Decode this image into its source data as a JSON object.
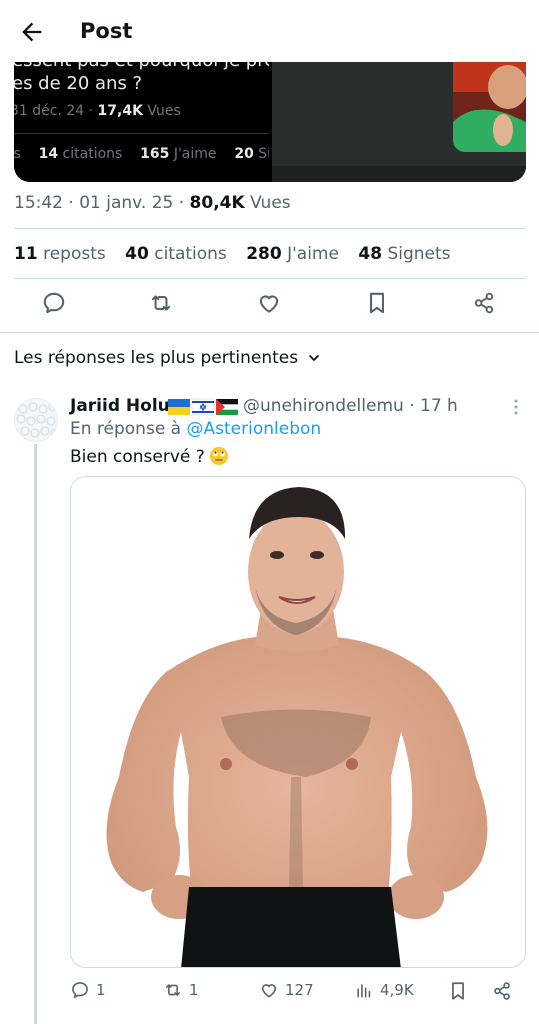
{
  "header": {
    "title": "Post",
    "back_icon": "arrow-left-icon"
  },
  "quoted_card": {
    "cut_line": "essent pas et pourquoi je préfè",
    "text_line": "es de 20 ans ?",
    "date": "31 déc. 24 · ",
    "views_value": "17,4K",
    "views_label": " Vues",
    "stats": [
      {
        "value": "",
        "label": "ts"
      },
      {
        "value": "14",
        "label": "citations"
      },
      {
        "value": "165",
        "label": "J'aime"
      },
      {
        "value": "20",
        "label": "Signets"
      }
    ]
  },
  "post": {
    "time": "15:42 · 01 janv. 25 · ",
    "views_value": "80,4K",
    "views_label": " Vues",
    "reposts_count": "11",
    "reposts_label": "reposts",
    "quotes_count": "40",
    "quotes_label": "citations",
    "likes_count": "280",
    "likes_label": "J'aime",
    "bookmarks_count": "48",
    "bookmarks_label": "Signets"
  },
  "actions": [
    "reply-icon",
    "repost-icon",
    "like-icon",
    "bookmark-icon",
    "share-icon"
  ],
  "replies_sort": {
    "label": "Les réponses les plus pertinentes"
  },
  "reply": {
    "name": "Jariid Holu",
    "handle": "@unehirondellemu · 17 h",
    "reply_prefix": "En réponse à ",
    "reply_mention": "@Asterionlebon",
    "text": "Bien conservé ?",
    "emoji": "rolling-eyes-emoji",
    "counts": {
      "replies": "1",
      "reposts": "1",
      "likes": "127",
      "views": "4,9K"
    }
  },
  "colors": {
    "accent": "#1d9bf0",
    "secondary_text": "#536471",
    "divider": "#cfd9de"
  }
}
